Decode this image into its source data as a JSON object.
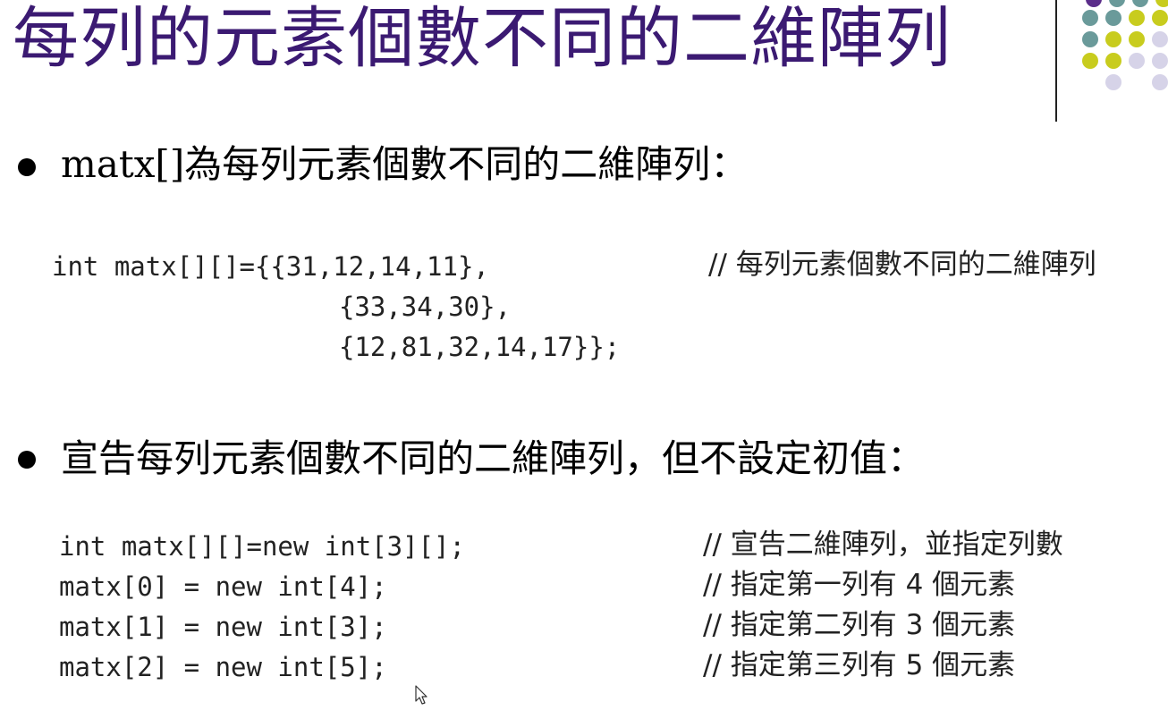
{
  "title": "每列的元素個數不同的二維陣列",
  "bullets": [
    {
      "latin": "matx[]",
      "cjk": "為每列元素個數不同的二維陣列："
    },
    {
      "text": "宣告每列元素個數不同的二維陣列，但不設定初值："
    }
  ],
  "code_block_1": {
    "lines": [
      "int matx[][]={{31,12,14,11},",
      "             {33,34,30},",
      "             {12,81,32,14,17}};"
    ],
    "comment": "// 每列元素個數不同的二維陣列"
  },
  "code_block_2": {
    "lines": [
      {
        "code": "int matx[][]=new int[3][];",
        "comment": "// 宣告二維陣列，並指定列數"
      },
      {
        "code": "matx[0] = new int[4];",
        "comment": "// 指定第一列有 4 個元素"
      },
      {
        "code": "matx[1] = new int[3];",
        "comment": "// 指定第二列有 3 個元素"
      },
      {
        "code": "matx[2] = new int[5];",
        "comment": "// 指定第三列有 5 個元素"
      }
    ]
  },
  "decoration": {
    "dot_colors": {
      "purple": "#5b2d8a",
      "teal": "#6a9a9a",
      "olive": "#c8cc1e",
      "lavender": "#d6d3e8"
    }
  }
}
